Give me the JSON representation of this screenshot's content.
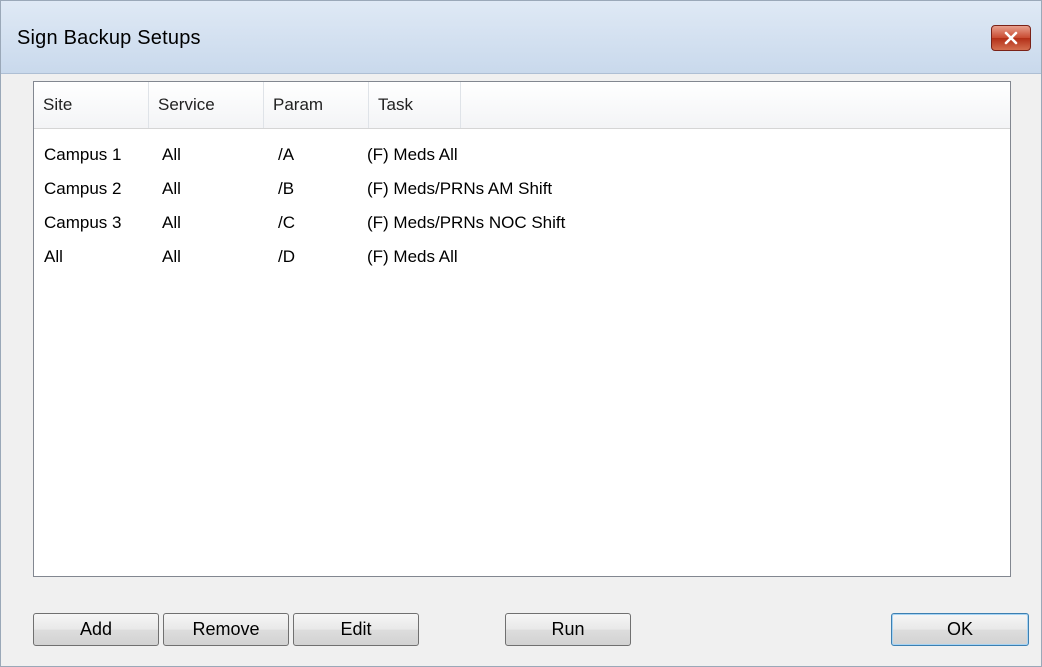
{
  "window": {
    "title": "Sign Backup Setups"
  },
  "table": {
    "columns": [
      "Site",
      "Service",
      "Param",
      "Task"
    ],
    "rows": [
      [
        "Campus 1",
        "All",
        "/A",
        "(F) Meds All"
      ],
      [
        "Campus 2",
        "All",
        "/B",
        "(F) Meds/PRNs AM Shift"
      ],
      [
        "Campus 3",
        "All",
        "/C",
        "(F) Meds/PRNs NOC Shift"
      ],
      [
        "All",
        "All",
        "/D",
        "(F) Meds All"
      ]
    ]
  },
  "buttons": {
    "add": "Add",
    "remove": "Remove",
    "edit": "Edit",
    "run": "Run",
    "ok": "OK"
  },
  "icons": {
    "close": "close-icon"
  },
  "colors": {
    "close_button": "#c84a30",
    "titlebar": "#d5e3f2"
  }
}
